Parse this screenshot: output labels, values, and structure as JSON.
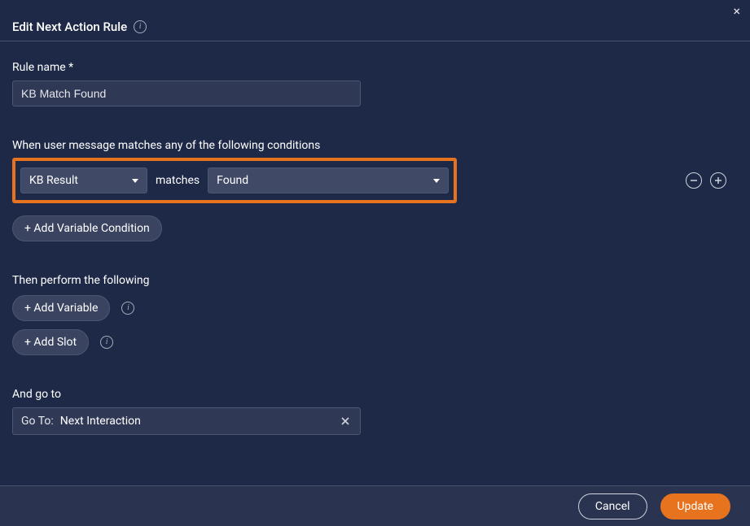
{
  "dialog": {
    "title": "Edit Next Action Rule",
    "close_label": "×"
  },
  "rule_name": {
    "label": "Rule name *",
    "value": "KB Match Found"
  },
  "conditions": {
    "label": "When user message matches any of the following conditions",
    "row": {
      "variable": "KB Result",
      "operator": "matches",
      "value": "Found"
    },
    "add_button": "+ Add Variable Condition"
  },
  "then": {
    "label": "Then perform the following",
    "add_variable": "+ Add Variable",
    "add_slot": "+ Add Slot"
  },
  "goto": {
    "label": "And go to",
    "prefix": "Go To:",
    "value": "Next Interaction"
  },
  "footer": {
    "cancel": "Cancel",
    "update": "Update"
  },
  "icons": {
    "info": "i"
  }
}
